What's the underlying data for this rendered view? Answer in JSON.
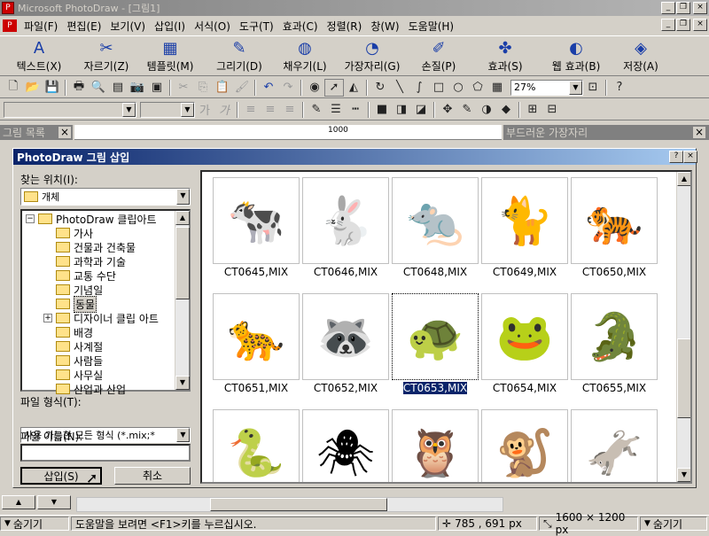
{
  "window": {
    "title": "Microsoft PhotoDraw - [그림1]"
  },
  "menu": [
    "파일(F)",
    "편집(E)",
    "보기(V)",
    "삽입(I)",
    "서식(O)",
    "도구(T)",
    "효과(C)",
    "정렬(R)",
    "창(W)",
    "도움말(H)"
  ],
  "big_toolbar": [
    {
      "label": "텍스트(X)",
      "icon": "text-icon",
      "glyph": "A"
    },
    {
      "label": "자르기(Z)",
      "icon": "scissors-icon",
      "glyph": "✂"
    },
    {
      "label": "템플릿(M)",
      "icon": "template-icon",
      "glyph": "▦"
    },
    {
      "label": "그리기(D)",
      "icon": "pen-icon",
      "glyph": "✎"
    },
    {
      "label": "채우기(L)",
      "icon": "paint-bucket-icon",
      "glyph": "◍"
    },
    {
      "label": "가장자리(G)",
      "icon": "edge-icon",
      "glyph": "◔"
    },
    {
      "label": "손질(P)",
      "icon": "brush-icon",
      "glyph": "✐"
    },
    {
      "label": "효과(S)",
      "icon": "effects-icon",
      "glyph": "✤"
    },
    {
      "label": "웹 효과(B)",
      "icon": "web-effects-icon",
      "glyph": "◐"
    },
    {
      "label": "저장(A)",
      "icon": "save-icon",
      "glyph": "◈"
    }
  ],
  "std_toolbar": {
    "zoom": "27%"
  },
  "ruler": {
    "mark": "1000"
  },
  "side_panels": {
    "left_title": "그림 목록",
    "right_title": "부드러운 가장자리"
  },
  "dialog": {
    "title": "PhotoDraw 그림 삽입",
    "help_btn": "?",
    "close_btn": "×",
    "look_in_label": "찾는 위치(I):",
    "look_in_value": "개체",
    "tree": [
      {
        "label": "PhotoDraw 클립아트",
        "level": 0,
        "expander": "−"
      },
      {
        "label": "가사",
        "level": 1
      },
      {
        "label": "건물과 건축물",
        "level": 1
      },
      {
        "label": "과학과 기술",
        "level": 1
      },
      {
        "label": "교통 수단",
        "level": 1
      },
      {
        "label": "기념일",
        "level": 1
      },
      {
        "label": "동물",
        "level": 1,
        "selected": true
      },
      {
        "label": "디자이너 클립 아트",
        "level": 1,
        "expander": "+"
      },
      {
        "label": "배경",
        "level": 1
      },
      {
        "label": "사계절",
        "level": 1
      },
      {
        "label": "사람들",
        "level": 1
      },
      {
        "label": "사무실",
        "level": 1
      },
      {
        "label": "산업과 산업",
        "level": 1
      }
    ],
    "file_type_label": "파일 형식(T):",
    "file_type_value": "사용 가능한 모든 형식 (*.mix;*",
    "file_name_label": "파일 이름(N):",
    "file_name_value": "",
    "insert_btn": "삽입(S)",
    "cancel_btn": "취소",
    "thumbnails": [
      {
        "name": "CT0645,MIX",
        "emoji": "🐄"
      },
      {
        "name": "CT0646,MIX",
        "emoji": "🐇"
      },
      {
        "name": "CT0648,MIX",
        "emoji": "🐀"
      },
      {
        "name": "CT0649,MIX",
        "emoji": "🐈"
      },
      {
        "name": "CT0650,MIX",
        "emoji": "🐅"
      },
      {
        "name": "CT0651,MIX",
        "emoji": "🐆"
      },
      {
        "name": "CT0652,MIX",
        "emoji": "🦝"
      },
      {
        "name": "CT0653,MIX",
        "emoji": "🐢",
        "selected": true
      },
      {
        "name": "CT0654,MIX",
        "emoji": "🐸"
      },
      {
        "name": "CT0655,MIX",
        "emoji": "🐊"
      },
      {
        "name": "",
        "emoji": "🐍"
      },
      {
        "name": "",
        "emoji": "🕷"
      },
      {
        "name": "",
        "emoji": "🦉"
      },
      {
        "name": "",
        "emoji": "🐒"
      },
      {
        "name": "",
        "emoji": "🫏"
      }
    ]
  },
  "status": {
    "hide_left": "숨기기",
    "help_text": "도움말을 보려면 <F1>키를 누르십시오.",
    "coords": "785 , 691  px",
    "size": "1600 × 1200  px",
    "hide_right": "숨기기"
  }
}
